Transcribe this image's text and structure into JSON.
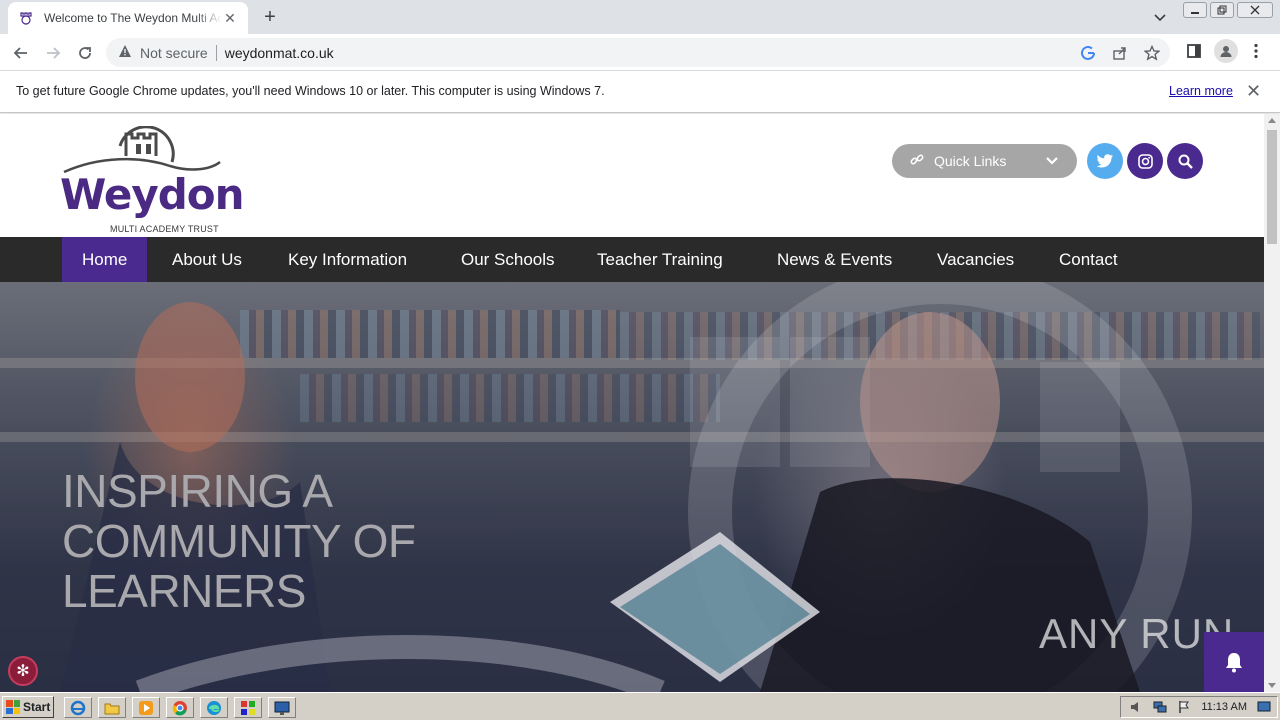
{
  "browser": {
    "tab_title": "Welcome to The Weydon Multi Academy Trust",
    "url": "weydonmat.co.uk",
    "security_label": "Not secure"
  },
  "infobar": {
    "message": "To get future Google Chrome updates, you'll need Windows 10 or later. This computer is using Windows 7.",
    "link": "Learn more"
  },
  "site": {
    "logo_word": "Weydon",
    "logo_sub": "MULTI ACADEMY TRUST",
    "quick_links_label": "Quick Links",
    "nav": [
      {
        "label": "Home",
        "active": true
      },
      {
        "label": "About Us"
      },
      {
        "label": "Key Information"
      },
      {
        "label": "Our Schools"
      },
      {
        "label": "Teacher Training"
      },
      {
        "label": "News & Events"
      },
      {
        "label": "Vacancies"
      },
      {
        "label": "Contact"
      }
    ],
    "hero_headline": "INSPIRING A COMMUNITY OF LEARNERS",
    "brand_color": "#4b2a8f",
    "twitter_color": "#55acee"
  },
  "overlay": {
    "watermark": "ANY RUN"
  },
  "taskbar": {
    "start_label": "Start",
    "clock": "11:13 AM"
  }
}
